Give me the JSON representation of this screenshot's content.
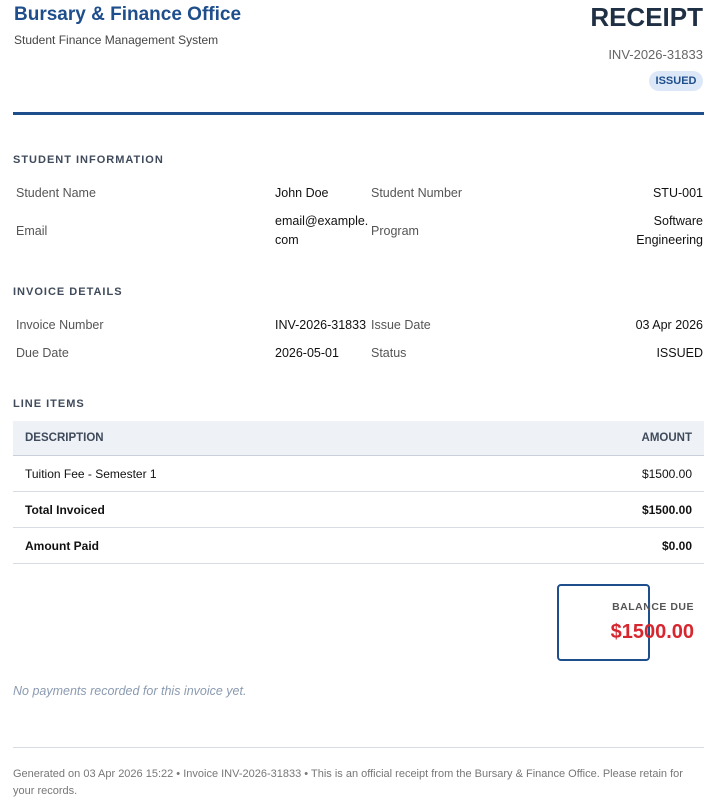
{
  "header": {
    "org_name": "Bursary & Finance Office",
    "org_subtitle": "Student Finance Management System",
    "doc_title": "RECEIPT",
    "invoice_number": "INV-2026-31833",
    "status_badge": "ISSUED"
  },
  "student_info": {
    "section_title": "STUDENT INFORMATION",
    "name_label": "Student Name",
    "name_value": "John Doe",
    "number_label": "Student Number",
    "number_value": "STU-001",
    "email_label": "Email",
    "email_value": "email@example.com",
    "program_label": "Program",
    "program_value": "Software Engineering"
  },
  "invoice_details": {
    "section_title": "INVOICE DETAILS",
    "invoice_number_label": "Invoice Number",
    "invoice_number_value": "INV-2026-31833",
    "issue_date_label": "Issue Date",
    "issue_date_value": "03 Apr 2026",
    "due_date_label": "Due Date",
    "due_date_value": "2026-05-01",
    "status_label": "Status",
    "status_value": "ISSUED"
  },
  "line_items": {
    "section_title": "LINE ITEMS",
    "columns": [
      "DESCRIPTION",
      "AMOUNT"
    ],
    "rows": [
      {
        "description": "Tuition Fee - Semester 1",
        "amount": "$1500.00"
      }
    ],
    "total_invoiced_label": "Total Invoiced",
    "total_invoiced_value": "$1500.00",
    "amount_paid_label": "Amount Paid",
    "amount_paid_value": "$0.00"
  },
  "balance": {
    "label": "BALANCE DUE",
    "value": "$1500.00"
  },
  "payments_note": "No payments recorded for this invoice yet.",
  "footer": "Generated on 03 Apr 2026 15:22 • Invoice INV-2026-31833 • This is an official receipt from the Bursary & Finance Office. Please retain for your records.",
  "colors": {
    "brand": "#1f4e8c",
    "balance": "#d7262e",
    "badge_bg": "#dce8f8"
  }
}
